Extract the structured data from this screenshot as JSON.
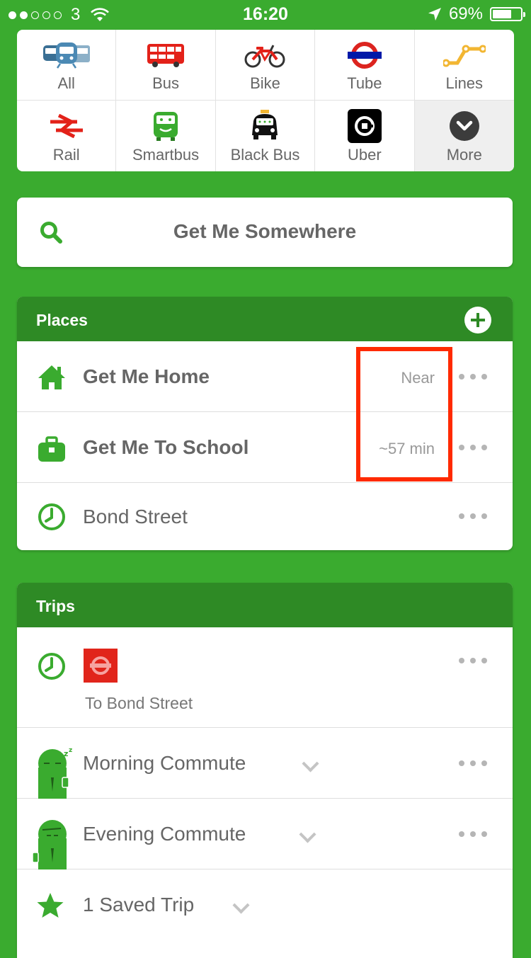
{
  "status_bar": {
    "signal_dots_filled": 2,
    "signal_dots_total": 5,
    "carrier": "3",
    "time": "16:20",
    "battery_percent_text": "69%",
    "battery_level": 0.69
  },
  "modes": [
    {
      "label": "All",
      "icon": "all-transport-icon"
    },
    {
      "label": "Bus",
      "icon": "bus-icon"
    },
    {
      "label": "Bike",
      "icon": "bike-icon"
    },
    {
      "label": "Tube",
      "icon": "tube-roundel-icon"
    },
    {
      "label": "Lines",
      "icon": "lines-icon"
    },
    {
      "label": "Rail",
      "icon": "national-rail-icon"
    },
    {
      "label": "Smartbus",
      "icon": "smartbus-icon"
    },
    {
      "label": "Black Bus",
      "icon": "black-bus-icon"
    },
    {
      "label": "Uber",
      "icon": "uber-icon"
    },
    {
      "label": "More",
      "icon": "more-chevron-icon"
    }
  ],
  "search": {
    "label": "Get Me Somewhere"
  },
  "places": {
    "title": "Places",
    "items": [
      {
        "label": "Get Me Home",
        "value": "Near",
        "icon": "home-icon"
      },
      {
        "label": "Get Me To School",
        "value": "~57 min",
        "icon": "briefcase-icon"
      },
      {
        "label": "Bond Street",
        "value": "",
        "icon": "clock-icon"
      }
    ]
  },
  "trips": {
    "title": "Trips",
    "items": [
      {
        "label": "",
        "subtitle": "To Bond Street",
        "icon": "clock-icon",
        "badge_icon": "tube-roundel-icon"
      },
      {
        "label": "Morning Commute",
        "icon": "sleepy-commuter-icon"
      },
      {
        "label": "Evening Commute",
        "icon": "happy-commuter-icon"
      },
      {
        "label": "1 Saved Trip",
        "icon": "star-icon"
      }
    ]
  },
  "colors": {
    "brand_green": "#3aab2f",
    "header_green": "#2e8a25",
    "highlight_red": "#ff2a00",
    "tube_red": "#e1251b"
  }
}
